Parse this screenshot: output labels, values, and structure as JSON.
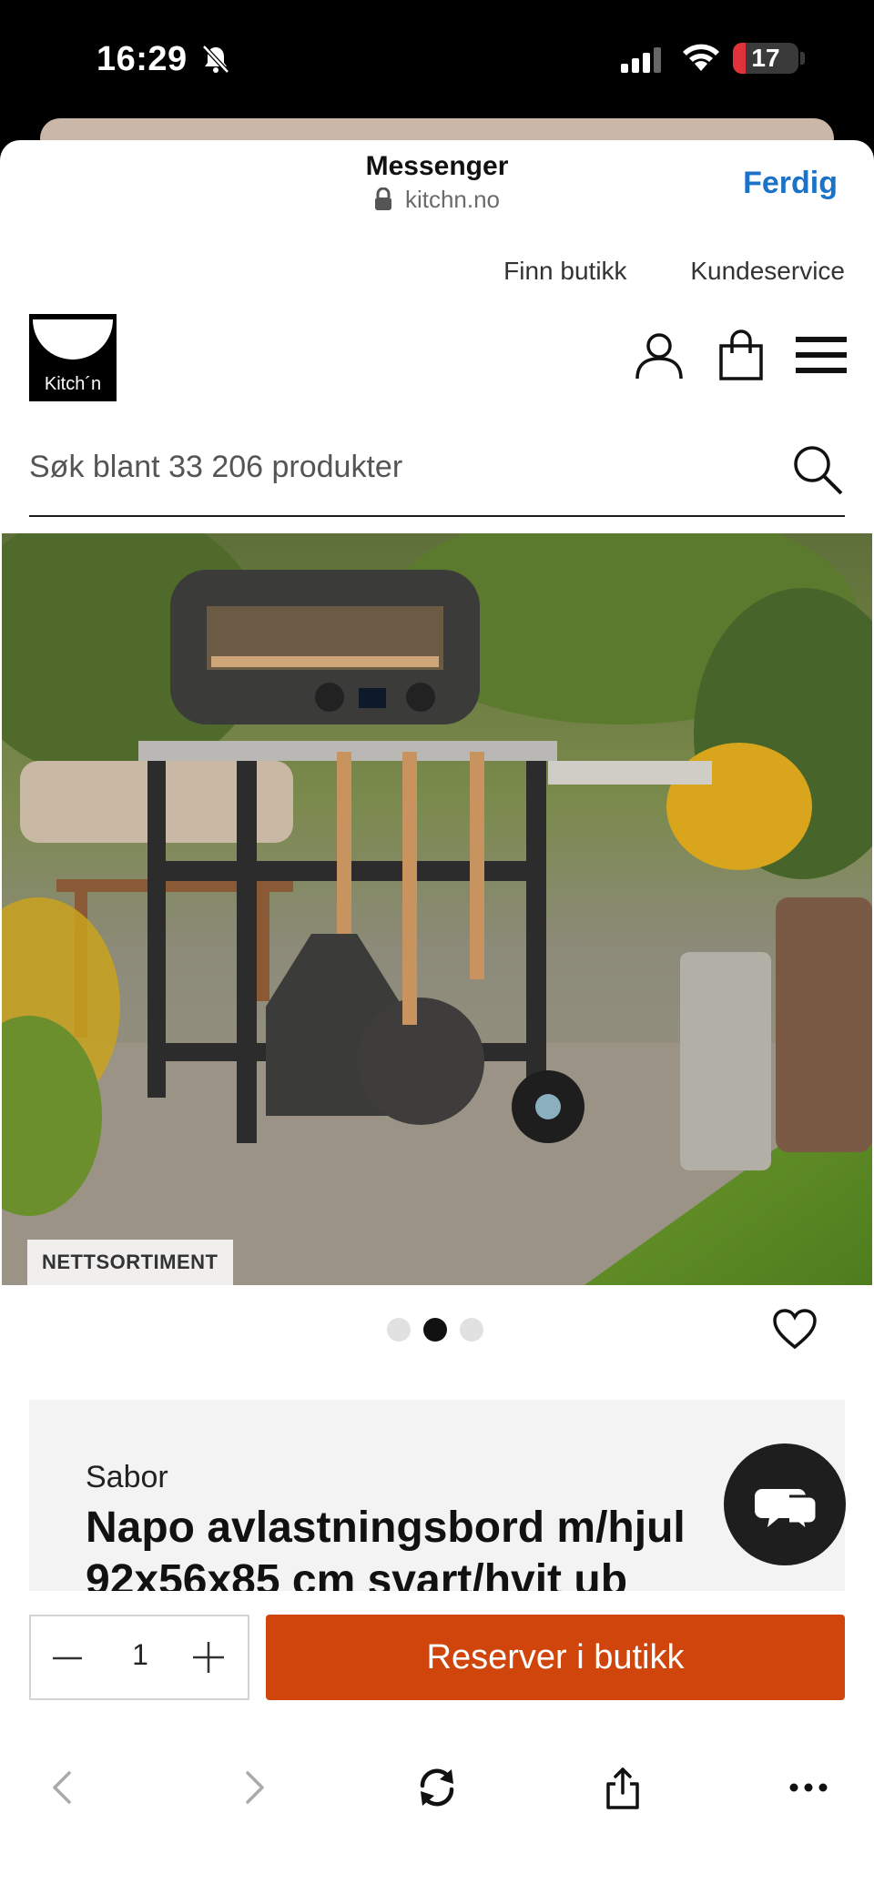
{
  "status_bar": {
    "time": "16:29",
    "battery": "17",
    "icons": [
      "bell-slash-icon",
      "cellular-signal-icon",
      "wifi-icon",
      "battery-icon"
    ]
  },
  "browser": {
    "title": "Messenger",
    "url": "kitchn.no",
    "done_label": "Ferdig",
    "lock_icon": "lock-icon"
  },
  "site": {
    "top_links": [
      "Finn butikk",
      "Kundeservice"
    ],
    "logo_text": "Kitch´n",
    "header_icons": [
      "user-icon",
      "shopping-bag-icon",
      "hamburger-menu-icon"
    ],
    "search_placeholder": "Søk blant 33 206 produkter"
  },
  "product": {
    "badge": "NETTSORTIMENT",
    "gallery": {
      "count": 3,
      "active_index": 1
    },
    "brand": "Sabor",
    "title_line1": "Napo avlastningsbord m/hjul",
    "title_line2": "92x56x85 cm svart/hvit ub"
  },
  "purchase": {
    "quantity": "1",
    "reserve_label": "Reserver i butikk"
  },
  "toolbar": {
    "icons": [
      "back-icon",
      "forward-icon",
      "reload-icon",
      "share-icon",
      "more-icon"
    ]
  },
  "colors": {
    "accent_link": "#1a73c8",
    "reserve_button": "#d0450b",
    "battery_low": "#e0323a"
  }
}
